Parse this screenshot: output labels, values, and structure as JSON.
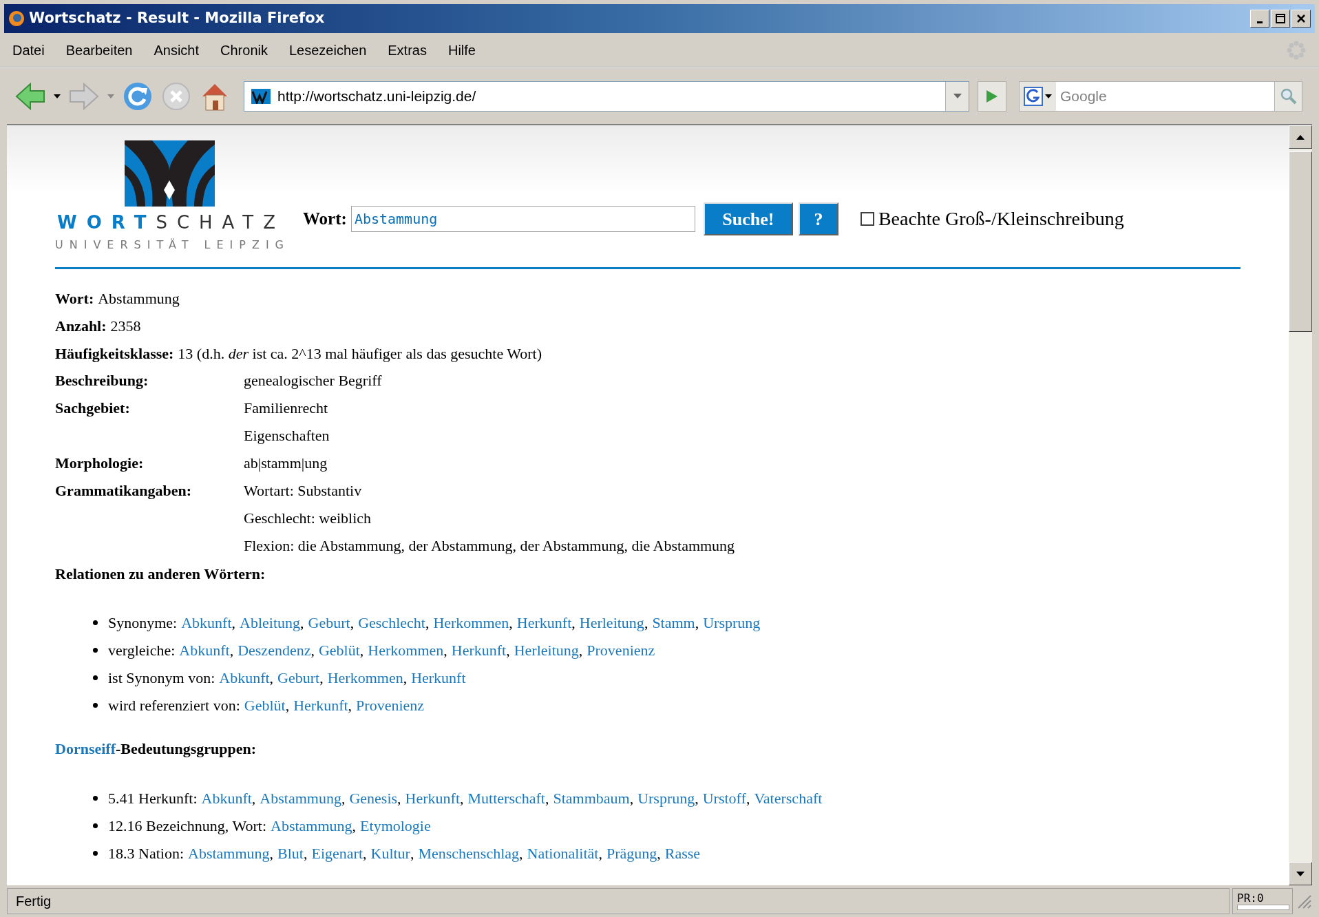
{
  "window": {
    "title": "Wortschatz - Result - Mozilla Firefox"
  },
  "menu": [
    "Datei",
    "Bearbeiten",
    "Ansicht",
    "Chronik",
    "Lesezeichen",
    "Extras",
    "Hilfe"
  ],
  "toolbar": {
    "address": "http://wortschatz.uni-leipzig.de/",
    "search_placeholder": "Google"
  },
  "logo": {
    "word_accent": "WORT",
    "word_rest": "SCHATZ",
    "subtitle": "UNIVERSITÄT LEIPZIG"
  },
  "search_form": {
    "label": "Wort:",
    "value": "Abstammung",
    "buttons": [
      "Suche!",
      "?"
    ],
    "checkbox": {
      "label": "Beachte Groß-/Kleinschreibung",
      "checked": false
    }
  },
  "info": [
    {
      "kind": "inline",
      "label": "Wort:",
      "values": [
        "Abstammung"
      ]
    },
    {
      "kind": "inline",
      "label": "Anzahl:",
      "values": [
        "2358"
      ]
    },
    {
      "kind": "inline",
      "label": "Häufigkeitsklasse:",
      "values": [
        "13 (d.h. *der* ist ca. 2^13 mal häufiger als das gesuchte Wort)"
      ]
    },
    {
      "kind": "table",
      "label": "Beschreibung:",
      "values": [
        "genealogischer Begriff"
      ]
    },
    {
      "kind": "table",
      "label": "Sachgebiet:",
      "values": [
        "Familienrecht",
        "Eigenschaften"
      ]
    },
    {
      "kind": "table",
      "label": "Morphologie:",
      "values": [
        "ab|stamm|ung"
      ]
    },
    {
      "kind": "table",
      "label": "Grammatikangaben:",
      "values": [
        "Wortart: Substantiv",
        "Geschlecht: weiblich",
        "Flexion: die Abstammung, der Abstammung, der Abstammung, die Abstammung"
      ]
    }
  ],
  "relations": {
    "heading": "Relationen zu anderen Wörtern:",
    "separator": ",",
    "items": [
      {
        "label": "Synonyme:",
        "links": [
          "Abkunft",
          "Ableitung",
          "Geburt",
          "Geschlecht",
          "Herkommen",
          "Herkunft",
          "Herleitung",
          "Stamm",
          "Ursprung"
        ]
      },
      {
        "label": "vergleiche:",
        "links": [
          "Abkunft",
          "Deszendenz",
          "Geblüt",
          "Herkommen",
          "Herkunft",
          "Herleitung",
          "Provenienz"
        ]
      },
      {
        "label": "ist Synonym von:",
        "links": [
          "Abkunft",
          "Geburt",
          "Herkommen",
          "Herkunft"
        ]
      },
      {
        "label": "wird referenziert von:",
        "links": [
          "Geblüt",
          "Herkunft",
          "Provenienz"
        ]
      }
    ]
  },
  "dornseiff": {
    "link": "Dornseiff",
    "heading_rest": "-Bedeutungsgruppen:",
    "separator": ",",
    "items": [
      {
        "label": "5.41 Herkunft:",
        "links": [
          "Abkunft",
          "Abstammung",
          "Genesis",
          "Herkunft",
          "Mutterschaft",
          "Stammbaum",
          "Ursprung",
          "Urstoff",
          "Vaterschaft"
        ]
      },
      {
        "label": "12.16 Bezeichnung, Wort:",
        "links": [
          "Abstammung",
          "Etymologie"
        ]
      },
      {
        "label": "18.3 Nation:",
        "links": [
          "Abstammung",
          "Blut",
          "Eigenart",
          "Kultur",
          "Menschenschlag",
          "Nationalität",
          "Prägung",
          "Rasse"
        ]
      }
    ]
  },
  "status_bar": {
    "text": "Fertig",
    "panel": "PR:0"
  }
}
